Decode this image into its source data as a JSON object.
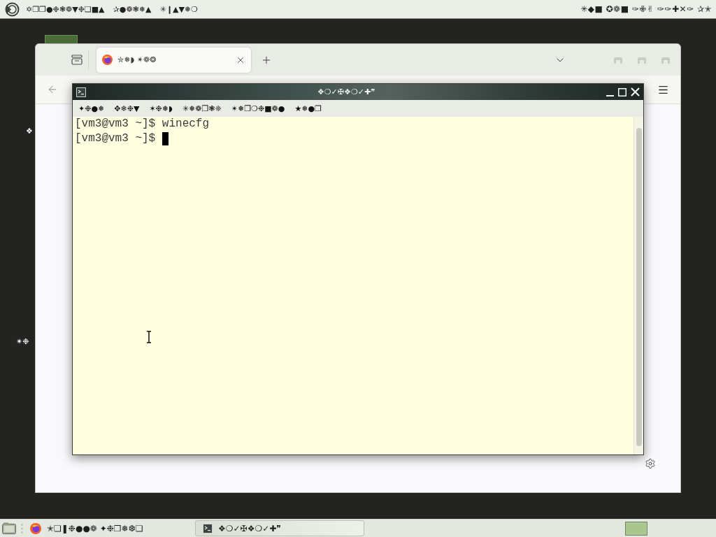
{
  "top_panel": {
    "menus": [
      "✡❐❐●❉❃❁▼❉❏■▲",
      "✰●❁❃❅▲",
      "✳❙▲▼❅❍"
    ],
    "clock": "✳◆■ ✪❁■ ✑✙✌ ✑✑✚✕✑ ✰✭"
  },
  "desktop_icons": [
    {
      "label": "❖"
    },
    {
      "label": "✴❉"
    }
  ],
  "browser": {
    "tabs": [
      {
        "title": "✮❅◗ ✴❁❂",
        "selected": true
      }
    ]
  },
  "terminal": {
    "title": "❖❍✓✠❖❍✓✚❞",
    "menus": [
      "✦❉●❅",
      "✥❄❉▼",
      "✶❉❅◗",
      "✳❅❁❒❃❈",
      "✴❅❒❍❉■❁●",
      "★❅●❐"
    ],
    "lines": [
      {
        "prompt": "[vm3@vm3 ~]$",
        "command": "winecfg",
        "cursor": false
      },
      {
        "prompt": "[vm3@vm3 ~]$",
        "cursor": true
      }
    ]
  },
  "taskbar": {
    "tasks": [
      {
        "kind": "browser",
        "title": "✭❏❚❉●●❁ ✦❉❒❅❆❏",
        "selected": false
      },
      {
        "kind": "terminal",
        "title": "❖❍✓✠❖❍✓✚❞",
        "selected": true
      }
    ]
  }
}
